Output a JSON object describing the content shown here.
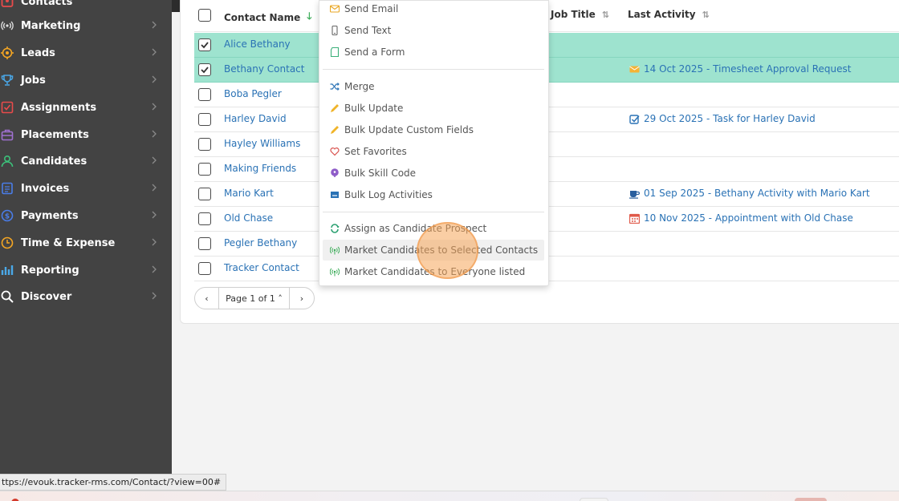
{
  "sidebar": {
    "items": [
      {
        "label": "Contacts",
        "icon": "contacts-icon",
        "color": "#e94b4b"
      },
      {
        "label": "Marketing",
        "icon": "broadcast-icon",
        "color": "#bfbfbf"
      },
      {
        "label": "Leads",
        "icon": "target-icon",
        "color": "#f5a623"
      },
      {
        "label": "Jobs",
        "icon": "trophy-icon",
        "color": "#4aa8e8"
      },
      {
        "label": "Assignments",
        "icon": "checkbox-icon",
        "color": "#e94b4b"
      },
      {
        "label": "Placements",
        "icon": "briefcase-icon",
        "color": "#a070d0"
      },
      {
        "label": "Candidates",
        "icon": "person-icon",
        "color": "#3cc07a"
      },
      {
        "label": "Invoices",
        "icon": "document-icon",
        "color": "#4a7de8"
      },
      {
        "label": "Payments",
        "icon": "dollar-icon",
        "color": "#4a7de8"
      },
      {
        "label": "Time & Expense",
        "icon": "clock-icon",
        "color": "#f5a623"
      },
      {
        "label": "Reporting",
        "icon": "bar-chart-icon",
        "color": "#4aa8e8"
      },
      {
        "label": "Discover",
        "icon": "search-icon",
        "color": "#ffffff"
      }
    ]
  },
  "table": {
    "columns": {
      "name": "Contact Name",
      "job_title": "Job Title",
      "last_activity": "Last Activity"
    },
    "rows": [
      {
        "name": "Alice Bethany",
        "checked": true,
        "activity": "",
        "activity_icon": ""
      },
      {
        "name": "Bethany Contact",
        "checked": true,
        "activity": "14 Oct 2025 - Timesheet Approval Request",
        "activity_icon": "envelope-icon"
      },
      {
        "name": "Boba Pegler",
        "checked": false,
        "activity": "",
        "activity_icon": ""
      },
      {
        "name": "Harley David",
        "checked": false,
        "activity": "29 Oct 2025 - Task for Harley David",
        "activity_icon": "task-check-icon"
      },
      {
        "name": "Hayley Williams",
        "checked": false,
        "activity": "",
        "activity_icon": ""
      },
      {
        "name": "Making Friends",
        "checked": false,
        "activity": "",
        "activity_icon": ""
      },
      {
        "name": "Mario Kart",
        "checked": false,
        "activity": "01 Sep 2025 - Bethany Activity with Mario Kart",
        "activity_icon": "coffee-icon"
      },
      {
        "name": "Old Chase",
        "checked": false,
        "activity": "10 Nov 2025 - Appointment with Old Chase",
        "activity_icon": "calendar-icon"
      },
      {
        "name": "Pegler Bethany",
        "checked": false,
        "activity": "",
        "activity_icon": ""
      },
      {
        "name": "Tracker Contact",
        "checked": false,
        "activity": "",
        "activity_icon": ""
      }
    ]
  },
  "pager": {
    "prev": "‹",
    "page_label": "Page 1 of 1 ˄",
    "next": "›"
  },
  "menu": {
    "items": [
      {
        "label": "Send Email",
        "icon": "envelope-icon"
      },
      {
        "label": "Send Text",
        "icon": "phone-icon"
      },
      {
        "label": "Send a Form",
        "icon": "form-icon"
      },
      {
        "label": "Merge",
        "icon": "shuffle-icon"
      },
      {
        "label": "Bulk Update",
        "icon": "pencil-icon"
      },
      {
        "label": "Bulk Update Custom Fields",
        "icon": "pencil-icon"
      },
      {
        "label": "Set Favorites",
        "icon": "heart-icon"
      },
      {
        "label": "Bulk Skill Code",
        "icon": "podcast-icon"
      },
      {
        "label": "Bulk Log Activities",
        "icon": "inbox-icon"
      },
      {
        "label": "Assign as Candidate Prospect",
        "icon": "recycle-icon"
      },
      {
        "label": "Market Candidates to Selected Contacts",
        "icon": "broadcast-icon"
      },
      {
        "label": "Market Candidates to Everyone listed",
        "icon": "broadcast-icon"
      }
    ],
    "hovered_index": 10
  },
  "status_bar": {
    "url": "ttps://evouk.tracker-rms.com/Contact/?view=00#"
  },
  "colors": {
    "sidebar_bg": "#434343",
    "selected_row": "#9ee3cf",
    "link_blue": "#2a72b5",
    "sort_green": "#3aab57"
  }
}
